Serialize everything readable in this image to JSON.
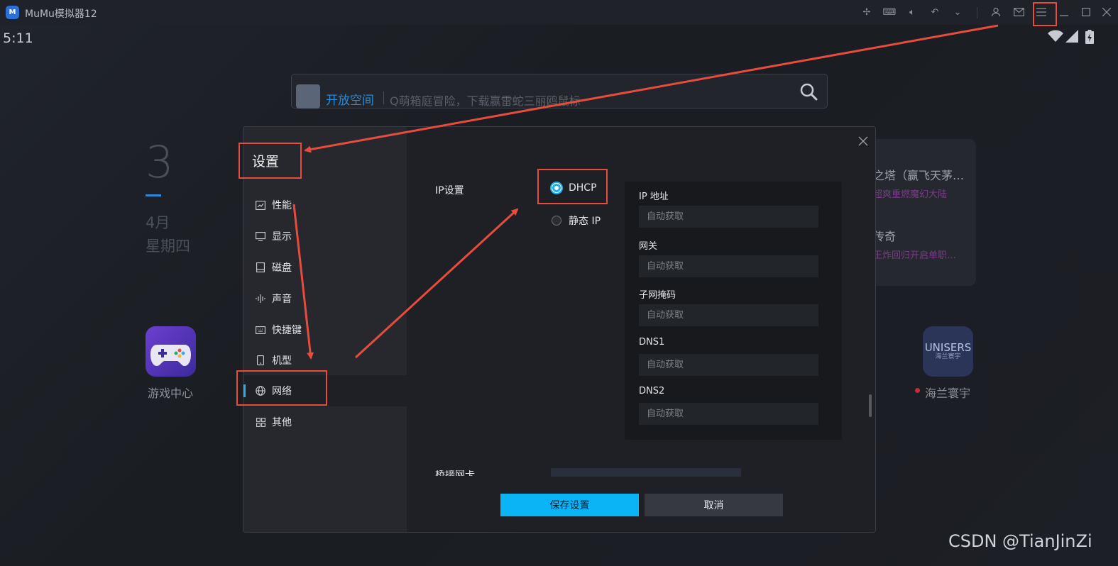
{
  "window": {
    "title": "MuMu模拟器12"
  },
  "status": {
    "time": "5:11"
  },
  "desktop": {
    "search_tag": "开放空间",
    "search_text": "Q萌箱庭冒险，下载赢雷蛇三丽鸥鼠标",
    "date_day": "3",
    "date_month": "4月",
    "date_weekday": "星期四",
    "app_game_center": "游戏中心",
    "app_hailan": "海兰寰宇",
    "app_hailan_icon_text": "UNISERS",
    "app_hailan_icon_sub": "海兰寰宇",
    "news": [
      {
        "title": "之塔（赢飞天茅…",
        "sub": "超爽重燃魔幻大陆"
      },
      {
        "title": "传奇",
        "sub": "王炸回归开启单职…"
      }
    ]
  },
  "settings": {
    "title": "设置",
    "nav": [
      {
        "label": "性能",
        "icon": "chart-icon"
      },
      {
        "label": "显示",
        "icon": "monitor-icon"
      },
      {
        "label": "磁盘",
        "icon": "disk-icon"
      },
      {
        "label": "声音",
        "icon": "sound-icon"
      },
      {
        "label": "快捷键",
        "icon": "keyboard-icon"
      },
      {
        "label": "机型",
        "icon": "phone-icon"
      },
      {
        "label": "网络",
        "icon": "globe-icon"
      },
      {
        "label": "其他",
        "icon": "grid-icon"
      }
    ],
    "active_nav": "网络",
    "ip_settings_label": "IP设置",
    "radio_dhcp": "DHCP",
    "radio_static": "静态 IP",
    "selected": "DHCP",
    "fields": [
      {
        "label": "IP 地址",
        "placeholder": "自动获取"
      },
      {
        "label": "网关",
        "placeholder": "自动获取"
      },
      {
        "label": "子网掩码",
        "placeholder": "自动获取"
      },
      {
        "label": "DNS1",
        "placeholder": "自动获取"
      },
      {
        "label": "DNS2",
        "placeholder": "自动获取"
      }
    ],
    "cut_label": "桥接网卡",
    "save": "保存设置",
    "cancel": "取消"
  },
  "watermark": "CSDN @TianJinZi",
  "annotation_color": "#e74c3c"
}
